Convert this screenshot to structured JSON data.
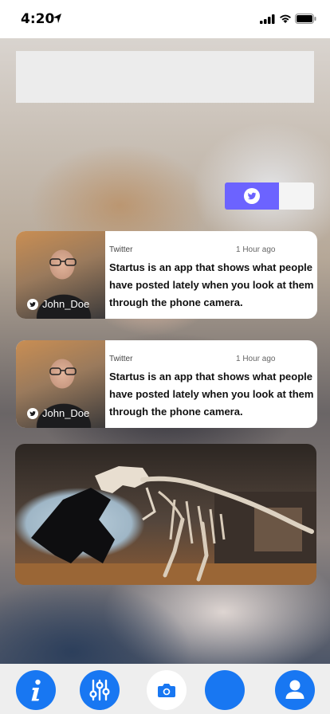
{
  "status_bar": {
    "time": "4:20"
  },
  "colors": {
    "accent": "#6c63ff",
    "nav_blue": "#1877f2",
    "card_bg": "#ffffff",
    "nav_bg": "#eeeeee"
  },
  "toggle": {
    "icon": "twitter-icon",
    "state": "on"
  },
  "posts": [
    {
      "source": "Twitter",
      "time": "1 Hour ago",
      "text": "Startus is an app that shows what people have posted lately when you look at them through the phone camera.",
      "username": "John_Doe"
    },
    {
      "source": "Twitter",
      "time": "1 Hour ago",
      "text": "Startus is an app that shows what people have posted lately when you look at them through the phone camera.",
      "username": "John_Doe"
    }
  ],
  "bottom_nav": {
    "items": [
      {
        "icon": "info-icon"
      },
      {
        "icon": "sliders-icon"
      },
      {
        "icon": "camera-icon"
      },
      {
        "icon": "blank-circle-icon"
      },
      {
        "icon": "user-icon"
      }
    ]
  }
}
